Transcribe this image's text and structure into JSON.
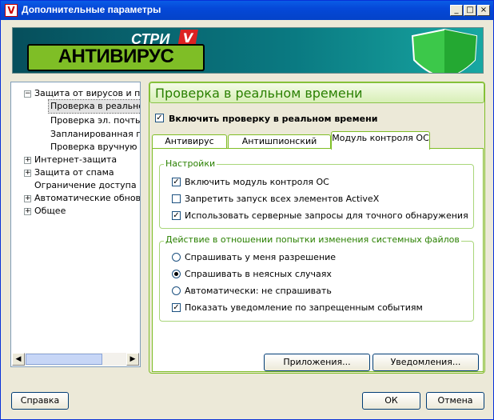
{
  "window": {
    "title": "Дополнительные параметры",
    "title_icon": "V"
  },
  "title_buttons": {
    "minimize": "_",
    "maximize": "□",
    "close": "×"
  },
  "banner": {
    "logo_sub": "СТРИ",
    "logo_v": "V",
    "logo_main": "АНТИВИРУС"
  },
  "tree": {
    "items": [
      {
        "label": "Защита от вирусов и прс",
        "expander": "−"
      },
      {
        "label": "Проверка в реальном"
      },
      {
        "label": "Проверка эл. почты"
      },
      {
        "label": "Запланированная пр"
      },
      {
        "label": "Проверка вручную"
      },
      {
        "label": "Интернет-защита",
        "expander": "+"
      },
      {
        "label": "Защита от спама",
        "expander": "+"
      },
      {
        "label": "Ограничение доступа"
      },
      {
        "label": "Автоматические обновле",
        "expander": "+"
      },
      {
        "label": "Общее",
        "expander": "+"
      }
    ]
  },
  "panel": {
    "title": "Проверка в реальном времени",
    "enable_label": "Включить проверку в реальном времени",
    "enable_checked": true
  },
  "tabs": [
    {
      "label": "Антивирус"
    },
    {
      "label": "Антишпионский модуль"
    },
    {
      "label": "Модуль контроля ОС",
      "active": true
    }
  ],
  "settings": {
    "legend": "Настройки",
    "options": [
      {
        "label": "Включить модуль контроля ОС",
        "checked": true
      },
      {
        "label": "Запретить запуск всех элементов ActiveX",
        "checked": false
      },
      {
        "label": "Использовать серверные запросы для точного обнаружения",
        "checked": true
      }
    ]
  },
  "action": {
    "legend": "Действие в отношении попытки изменения системных файлов",
    "radios": [
      {
        "label": "Спрашивать у меня разрешение",
        "selected": false
      },
      {
        "label": "Спрашивать в неясных случаях",
        "selected": true
      },
      {
        "label": "Автоматически: не спрашивать",
        "selected": false
      }
    ],
    "notify_label": "Показать уведомление по запрещенным событиям",
    "notify_checked": true
  },
  "buttons": {
    "apps": "Приложения...",
    "notifications": "Уведомления...",
    "help": "Справка",
    "ok": "ОК",
    "cancel": "Отмена"
  },
  "colors": {
    "accent_green": "#2a8000",
    "border_green": "#7fbe26",
    "title_blue": "#0548d8"
  }
}
